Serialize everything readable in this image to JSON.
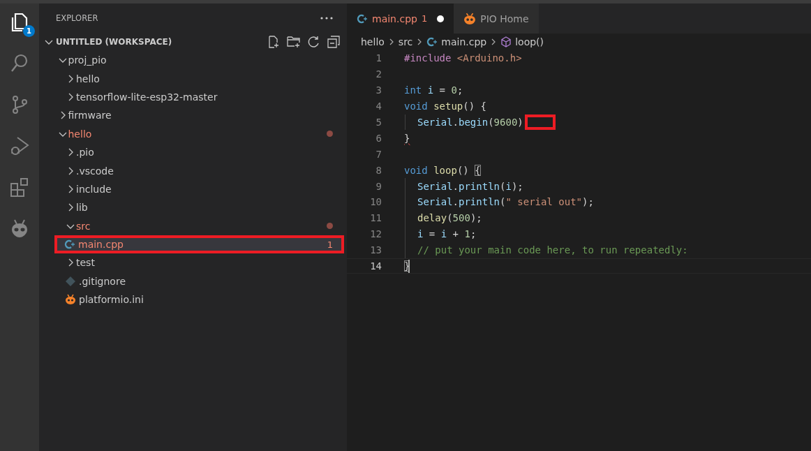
{
  "activity_bar": {
    "items": [
      {
        "kind": "explorer",
        "selected": true,
        "badge": "1"
      },
      {
        "kind": "search",
        "selected": false
      },
      {
        "kind": "source-control",
        "selected": false
      },
      {
        "kind": "run-debug",
        "selected": false
      },
      {
        "kind": "extensions",
        "selected": false
      },
      {
        "kind": "platformio",
        "selected": false
      }
    ]
  },
  "explorer": {
    "title": "EXPLORER",
    "workspace": {
      "label": "UNTITLED (WORKSPACE)",
      "expanded": true,
      "children": [
        {
          "label": "proj_pio",
          "kind": "folder",
          "expanded": true,
          "selected": false,
          "error": false,
          "children": [
            {
              "label": "hello",
              "kind": "folder",
              "expanded": false,
              "selected": false,
              "error": false
            },
            {
              "label": "tensorflow-lite-esp32-master",
              "kind": "folder",
              "expanded": false,
              "selected": false,
              "error": false
            }
          ]
        },
        {
          "label": "firmware",
          "kind": "folder",
          "expanded": false,
          "selected": false,
          "error": false
        },
        {
          "label": "hello",
          "kind": "folder",
          "expanded": true,
          "selected": false,
          "error": true,
          "dot": true,
          "children": [
            {
              "label": ".pio",
              "kind": "folder",
              "expanded": false,
              "selected": false,
              "error": false
            },
            {
              "label": ".vscode",
              "kind": "folder",
              "expanded": false,
              "selected": false,
              "error": false
            },
            {
              "label": "include",
              "kind": "folder",
              "expanded": false,
              "selected": false,
              "error": false
            },
            {
              "label": "lib",
              "kind": "folder",
              "expanded": false,
              "selected": false,
              "error": false
            },
            {
              "label": "src",
              "kind": "folder",
              "expanded": true,
              "selected": false,
              "error": true,
              "dot": true,
              "children": [
                {
                  "label": "main.cpp",
                  "kind": "cpp",
                  "selected": true,
                  "error": true,
                  "badge": "1",
                  "annotated": true
                }
              ]
            },
            {
              "label": "test",
              "kind": "folder",
              "expanded": false,
              "selected": false,
              "error": false
            },
            {
              "label": ".gitignore",
              "kind": "git",
              "selected": false,
              "error": false
            },
            {
              "label": "platformio.ini",
              "kind": "platformio",
              "selected": false,
              "error": false
            }
          ]
        }
      ]
    }
  },
  "tabs": [
    {
      "label": "main.cpp",
      "kind": "cpp",
      "badge": "1",
      "selected": true,
      "modified": true,
      "error": true
    },
    {
      "label": "PIO Home",
      "kind": "platformio",
      "selected": false,
      "modified": false,
      "error": false
    }
  ],
  "breadcrumbs": [
    {
      "label": "hello",
      "kind": "folder"
    },
    {
      "label": "src",
      "kind": "folder"
    },
    {
      "label": "main.cpp",
      "kind": "cpp"
    },
    {
      "label": "loop()",
      "kind": "symbol"
    }
  ],
  "code": [
    {
      "number": "1",
      "tokens": [
        {
          "text": "#include",
          "kind": "preproc"
        },
        {
          "text": " <Arduino.h>",
          "kind": "string"
        }
      ]
    },
    {
      "number": "2"
    },
    {
      "number": "3",
      "tokens": [
        {
          "text": "int",
          "kind": "keyword"
        },
        {
          "text": " i",
          "kind": "variable"
        },
        {
          "text": " = ",
          "kind": "plain"
        },
        {
          "text": "0",
          "kind": "number"
        },
        {
          "text": ";",
          "kind": "plain"
        }
      ]
    },
    {
      "number": "4",
      "tokens": [
        {
          "text": "void",
          "kind": "keyword"
        },
        {
          "text": " setup",
          "kind": "function"
        },
        {
          "text": "() {",
          "kind": "plain"
        }
      ]
    },
    {
      "number": "5",
      "indented": true,
      "annotated": true,
      "tokens": [
        {
          "text": "Serial",
          "kind": "variable"
        },
        {
          "text": ".",
          "kind": "plain"
        },
        {
          "text": "begin",
          "kind": "variable"
        },
        {
          "text": "(",
          "kind": "plain"
        },
        {
          "text": "9600",
          "kind": "number"
        },
        {
          "text": ")",
          "kind": "plain"
        }
      ]
    },
    {
      "number": "6",
      "tokens": [
        {
          "text": "}",
          "kind": "plain",
          "squiggle": true
        }
      ]
    },
    {
      "number": "7"
    },
    {
      "number": "8",
      "tokens": [
        {
          "text": "void",
          "kind": "keyword"
        },
        {
          "text": " loop",
          "kind": "function"
        },
        {
          "text": "() ",
          "kind": "plain"
        },
        {
          "text": "{",
          "kind": "plain",
          "bracket_match": true
        }
      ]
    },
    {
      "number": "9",
      "indented": true,
      "tokens": [
        {
          "text": "Serial",
          "kind": "variable"
        },
        {
          "text": ".",
          "kind": "plain"
        },
        {
          "text": "println",
          "kind": "variable"
        },
        {
          "text": "(",
          "kind": "plain"
        },
        {
          "text": "i",
          "kind": "variable"
        },
        {
          "text": ");",
          "kind": "plain"
        }
      ]
    },
    {
      "number": "10",
      "indented": true,
      "tokens": [
        {
          "text": "Serial",
          "kind": "variable"
        },
        {
          "text": ".",
          "kind": "plain"
        },
        {
          "text": "println",
          "kind": "variable"
        },
        {
          "text": "(",
          "kind": "plain"
        },
        {
          "text": "\" serial out\"",
          "kind": "string"
        },
        {
          "text": ");",
          "kind": "plain"
        }
      ]
    },
    {
      "number": "11",
      "indented": true,
      "tokens": [
        {
          "text": "delay",
          "kind": "function"
        },
        {
          "text": "(",
          "kind": "plain"
        },
        {
          "text": "500",
          "kind": "number"
        },
        {
          "text": ");",
          "kind": "plain"
        }
      ]
    },
    {
      "number": "12",
      "indented": true,
      "tokens": [
        {
          "text": "i",
          "kind": "variable"
        },
        {
          "text": " = ",
          "kind": "plain"
        },
        {
          "text": "i",
          "kind": "variable"
        },
        {
          "text": " + ",
          "kind": "plain"
        },
        {
          "text": "1",
          "kind": "number"
        },
        {
          "text": ";",
          "kind": "plain"
        }
      ]
    },
    {
      "number": "13",
      "indented": true,
      "tokens": [
        {
          "text": "// put your main code here, to run repeatedly:",
          "kind": "comment"
        }
      ]
    },
    {
      "number": "14",
      "current": true,
      "tokens": [
        {
          "text": "}",
          "kind": "plain",
          "bracket_match": true
        }
      ]
    }
  ]
}
